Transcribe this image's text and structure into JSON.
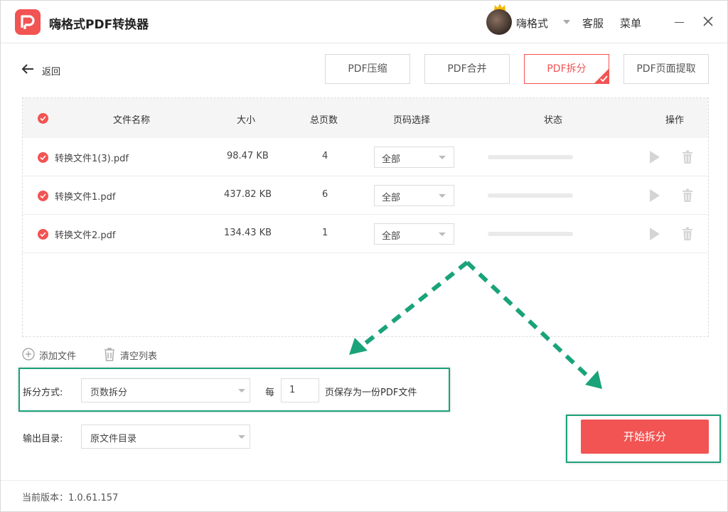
{
  "app": {
    "title": "嗨格式PDF转换器"
  },
  "user": {
    "name": "嗨格式"
  },
  "header": {
    "service": "客服",
    "menu": "菜单"
  },
  "toolbar": {
    "back": "返回"
  },
  "tabs": [
    {
      "label": "PDF压缩",
      "active": false
    },
    {
      "label": "PDF合并",
      "active": false
    },
    {
      "label": "PDF拆分",
      "active": true
    },
    {
      "label": "PDF页面提取",
      "active": false
    }
  ],
  "table": {
    "headers": {
      "name": "文件名称",
      "size": "大小",
      "pages": "总页数",
      "page_select": "页码选择",
      "status": "状态",
      "actions": "操作"
    },
    "rows": [
      {
        "name": "转换文件1(3).pdf",
        "size": "98.47 KB",
        "pages": "4",
        "page_select": "全部"
      },
      {
        "name": "转换文件1.pdf",
        "size": "437.82 KB",
        "pages": "6",
        "page_select": "全部"
      },
      {
        "name": "转换文件2.pdf",
        "size": "134.43 KB",
        "pages": "1",
        "page_select": "全部"
      }
    ]
  },
  "actions": {
    "add_file": "添加文件",
    "clear_list": "清空列表"
  },
  "split": {
    "mode_label": "拆分方式:",
    "mode_value": "页数拆分",
    "per_label": "每",
    "per_value": "1",
    "per_suffix": "页保存为一份PDF文件"
  },
  "output": {
    "label": "输出目录:",
    "value": "原文件目录"
  },
  "start_button": "开始拆分",
  "footer": {
    "version": "当前版本：1.0.61.157"
  },
  "colors": {
    "accent": "#f25353",
    "highlight": "#1aa37a"
  }
}
